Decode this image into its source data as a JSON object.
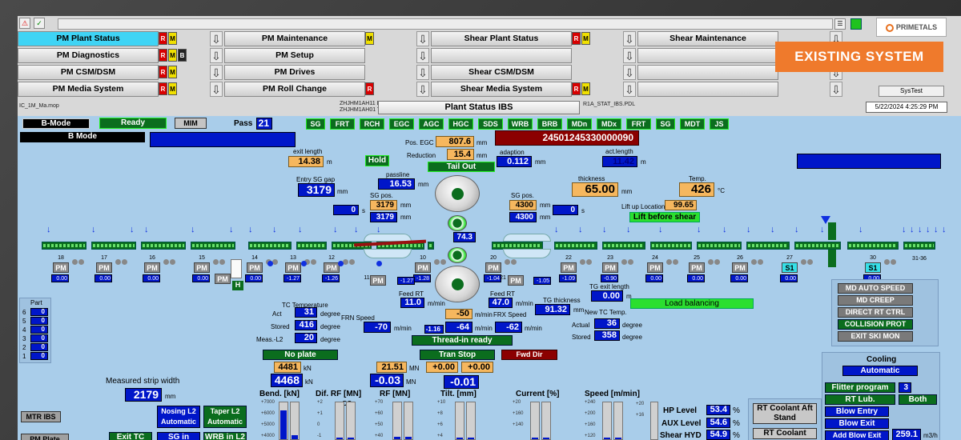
{
  "nav": {
    "rows": [
      [
        {
          "label": "PM Plant Status",
          "active": true,
          "flags": [
            "R",
            "M"
          ]
        },
        {
          "label": "PM Maintenance",
          "flags": [
            "M"
          ]
        },
        {
          "label": "Shear Plant Status",
          "flags": [
            "R",
            "M"
          ]
        },
        {
          "label": "Shear Maintenance",
          "flags": []
        }
      ],
      [
        {
          "label": "PM Diagnostics",
          "flags": [
            "R",
            "M",
            "B"
          ]
        },
        {
          "label": "PM Setup",
          "flags": []
        },
        {
          "label": "",
          "flags": []
        },
        {
          "label": "",
          "flags": []
        }
      ],
      [
        {
          "label": "PM CSM/DSM",
          "flags": [
            "R",
            "M"
          ]
        },
        {
          "label": "PM Drives",
          "flags": []
        },
        {
          "label": "Shear CSM/DSM",
          "flags": []
        },
        {
          "label": "",
          "flags": []
        }
      ],
      [
        {
          "label": "PM Media System",
          "flags": [
            "R",
            "M"
          ]
        },
        {
          "label": "PM Roll Change",
          "flags": [
            "R"
          ]
        },
        {
          "label": "Shear Media System",
          "flags": [
            "R",
            "M"
          ]
        },
        {
          "label": "",
          "flags": []
        }
      ]
    ],
    "brand": "PRIMETALS",
    "banner": "EXISTING SYSTEM",
    "systest": "SysTest",
    "file_left": "IC_1M_Ma.mop",
    "host1": "ZHJHM1AH11   L",
    "host2": "ZHJHM1AH01   T",
    "page_title": "Plant Status IBS",
    "file_right": "R1A_STAT_IBS.PDL",
    "datetime": "5/22/2024 4:25:29 PM"
  },
  "status": {
    "mode_button": "B-Mode",
    "mode_text": "B Mode",
    "ready": "Ready",
    "mim": "MIM",
    "pass_label": "Pass",
    "pass_value": "21",
    "tags": [
      "SG",
      "FRT",
      "RCH",
      "EGC",
      "AGC",
      "HGC",
      "SDS",
      "WRB",
      "BRB",
      "MDn",
      "MDx",
      "FRT",
      "SG",
      "MDT",
      "JS"
    ],
    "id_number": "24501245330000090"
  },
  "upper": {
    "exit_length_label": "exit length",
    "exit_length": "14.38",
    "exit_length_unit": "m",
    "pos_egc_label": "Pos. EGC",
    "pos_egc": "807.6",
    "pos_egc_unit": "mm",
    "reduction_label": "Reduction",
    "reduction": "15.4",
    "reduction_unit": "mm",
    "adaption_label": "adaption",
    "adaption": "0.112",
    "adaption_unit": "mm",
    "act_length_label": "act.length",
    "act_length": "11.42",
    "act_length_unit": "m",
    "hold": "Hold",
    "tail_out": "Tail Out",
    "entry_sg_gap_label": "Entry SG gap",
    "entry_sg_gap": "3179",
    "entry_sg_gap_unit": "mm",
    "passline_label": "passline",
    "passline": "16.53",
    "passline_unit": "mm",
    "sg_pos_left_label": "SG pos.",
    "sg_pos_left_1": "3179",
    "sg_pos_left_2": "3179",
    "sg_pos_unit": "mm",
    "sg_pos_right_label": "SG pos.",
    "sg_pos_right_1": "4300",
    "sg_pos_right_2": "4300",
    "time_left": "0",
    "time_right": "0",
    "time_unit": "s",
    "thickness_label": "thickness",
    "thickness": "65.00",
    "thickness_unit": "mm",
    "temp_label": "Temp.",
    "temp": "426",
    "temp_unit": "°C",
    "liftup_label": "Lift up Location",
    "liftup": "99.65",
    "lift_before_shear": "Lift before shear",
    "center_value": "74.3"
  },
  "stands": [
    {
      "no": "18",
      "value": "0.00"
    },
    {
      "no": "17",
      "value": "0.00"
    },
    {
      "no": "16",
      "value": "0.00"
    },
    {
      "no": "15",
      "value": "0.00"
    },
    {
      "no": "14",
      "value": "0.00"
    },
    {
      "no": "13",
      "value": "-1.27"
    },
    {
      "no": "12",
      "value": "-1.26"
    },
    {
      "no": "10",
      "value": "-1.28"
    },
    {
      "no": "20",
      "value": "-1.04"
    },
    {
      "no": "22",
      "value": "-1.09"
    },
    {
      "no": "23",
      "value": "-0.90"
    },
    {
      "no": "24",
      "value": "0.00"
    },
    {
      "no": "25",
      "value": "0.00"
    },
    {
      "no": "26",
      "value": "0.00"
    },
    {
      "no": "27",
      "value": "0.00"
    },
    {
      "no": "30",
      "value": "0.00"
    }
  ],
  "stand_extra": {
    "s11": "11",
    "s11_value": "-1.27",
    "s21": "21",
    "s21_value": "-1.05",
    "pm": "PM",
    "h": "H",
    "s1": "S1",
    "s31_36": "31-36"
  },
  "lower": {
    "feed_rt_left_label": "Feed RT",
    "feed_rt_left": "11.0",
    "feed_rt_unit": "m/min",
    "feed_rt_right_label": "Feed RT",
    "feed_rt_right": "47.0",
    "tg_thickness_label": "TG thickness",
    "tg_thickness": "91.32",
    "tg_thickness_unit": "mm",
    "tg_exit_length_label": "TG exit length",
    "tg_exit_length": "0.00",
    "tg_exit_length_unit": "m",
    "load_balancing": "Load balancing",
    "tc_temp_label": "TC Temperature",
    "act_label": "Act",
    "act": "31",
    "stored_label": "Stored",
    "stored": "416",
    "meas_label": "Meas.-L2",
    "meas": "20",
    "degree": "degree",
    "frn_speed_label": "FRN Speed",
    "frn_speed": "-70",
    "frn_unit": "m/min",
    "frx_speed_label": "FRX Speed",
    "frx_speed_1": "-50",
    "frx_speed_2": "-64",
    "frx_speed_3": "-62",
    "frx_unit": "m/min",
    "frx_left": "-1.16",
    "new_tc_label": "New TC Temp.",
    "tc_actual_label": "Actual",
    "tc_actual": "36",
    "tc_stored_label": "Stored",
    "tc_stored": "358",
    "thread_in_ready": "Thread-in ready",
    "no_plate": "No plate",
    "tran_stop": "Tran Stop",
    "fwd_dir": "Fwd Dir",
    "force1": "4481",
    "force2": "4468",
    "force_unit": "kN",
    "mn1": "21.51",
    "mn2": "-0.03",
    "mn_unit": "MN",
    "tilt1": "+0.00",
    "tilt2": "+0.00",
    "tilt3": "-0.01",
    "measured_width_label": "Measured strip width",
    "measured_width": "2179",
    "measured_width_unit": "mm",
    "nosing_l2": "Nosing L2",
    "nosing_auto": "Automatic",
    "taper_l2": "Taper L2",
    "taper_auto": "Automatic",
    "mtr_ibs": "MTR IBS",
    "pm_plate": "PM Plate",
    "exit_tc": "Exit TC",
    "sg_in": "SG in",
    "wrb_in_l2": "WRB in L2",
    "bend_label": "Bend. [kN]",
    "dif_rf_label": "Dif. RF [MN]",
    "ds": "DS",
    "rf_label": "RF [MN]",
    "tilt_label": "Tilt. [mm]",
    "current_label": "Current [%]",
    "speed_label": "Speed [m/min]",
    "hp_level_label": "HP Level",
    "hp_level": "53.4",
    "aux_level_label": "AUX Level",
    "aux_level": "54.6",
    "shear_hyd_label": "Shear HYD",
    "shear_hyd": "54.9",
    "pct": "%",
    "rt_coolant_aft": "RT Coolant Aft Stand",
    "rt_coolant": "RT Coolant"
  },
  "part": {
    "label": "Part",
    "rows": [
      {
        "n": "6",
        "v": "0"
      },
      {
        "n": "5",
        "v": "0"
      },
      {
        "n": "4",
        "v": "0"
      },
      {
        "n": "3",
        "v": "0"
      },
      {
        "n": "2",
        "v": "0"
      },
      {
        "n": "1",
        "v": "0"
      }
    ]
  },
  "md_panel": [
    "MD AUTO SPEED",
    "MD CREEP",
    "DIRECT RT CTRL",
    "COLLISION PROT",
    "EXIT SKI MON"
  ],
  "cooling": {
    "title": "Cooling",
    "mode": "Automatic",
    "flitter_program": "Flitter program",
    "flitter_value": "3",
    "rt_lub": "RT Lub.",
    "both": "Both",
    "blow_entry": "Blow Entry",
    "blow_exit": "Blow Exit",
    "add_blow_exit": "Add Blow Exit",
    "flow": "259.1",
    "flow_unit": "m3/h"
  },
  "gauges": {
    "bend_ticks": [
      "+7000",
      "+6000",
      "+5000",
      "+4000"
    ],
    "difrf_ticks": [
      "+2",
      "+1",
      "0",
      "-1"
    ],
    "rf_ticks": [
      "+70",
      "+60",
      "+50",
      "+40"
    ],
    "tilt_ticks": [
      "+10",
      "+8",
      "+6",
      "+4"
    ],
    "current_ticks": [
      "+20",
      "+160",
      "+140"
    ],
    "speed_ticks": [
      "+240",
      "+200",
      "+160",
      "+120"
    ],
    "hp_ticks": [
      "+20",
      "+16"
    ]
  }
}
